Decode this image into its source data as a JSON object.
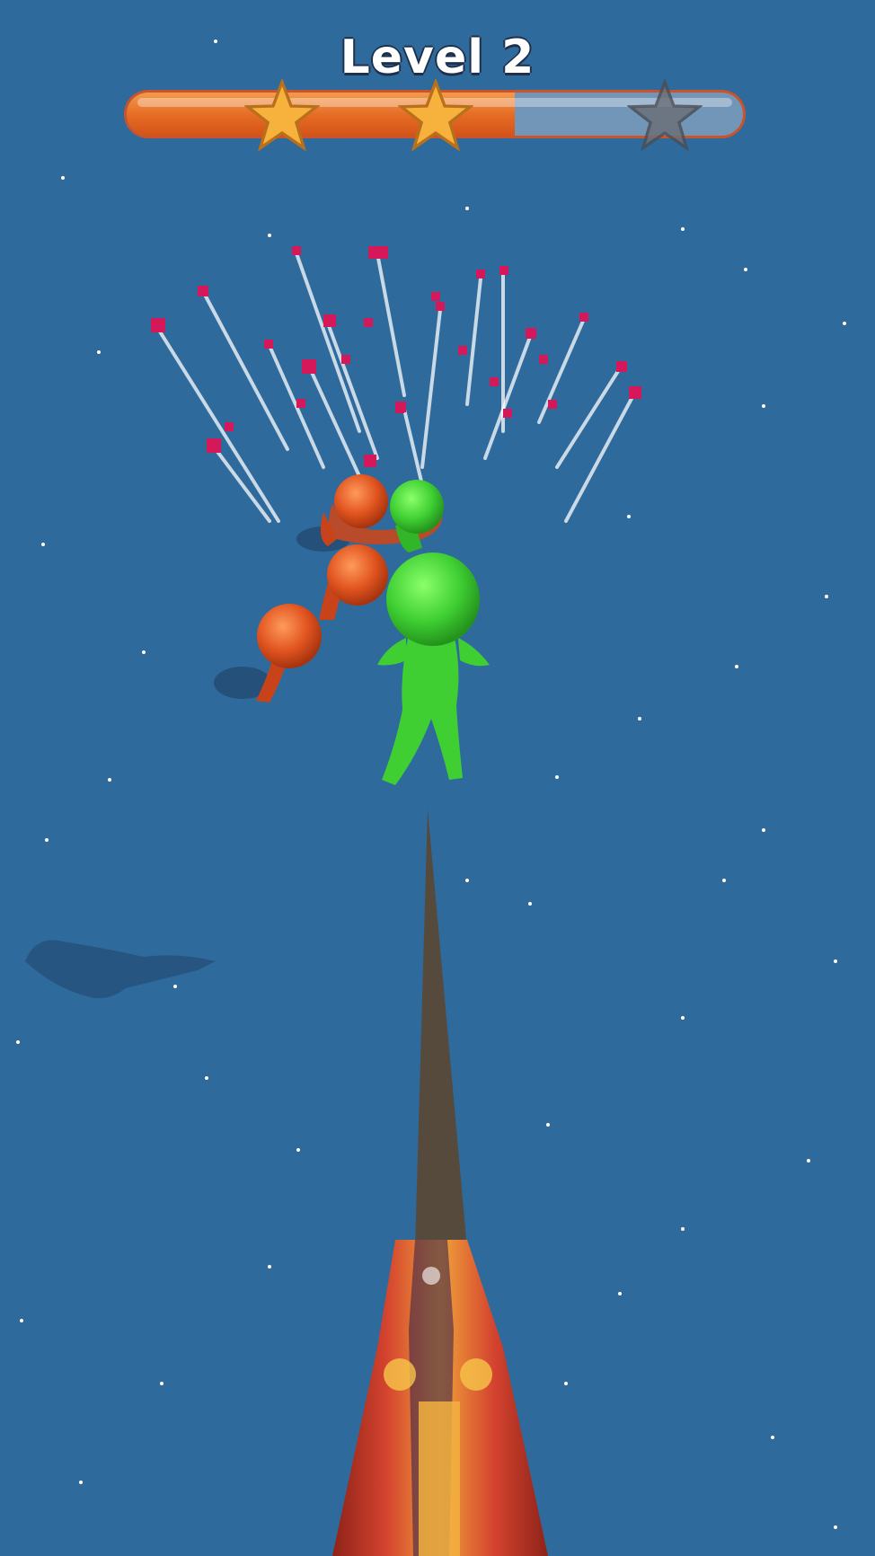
{
  "hud": {
    "level_label": "Level 2",
    "progress": 0.63,
    "stars": [
      {
        "name": "star-1",
        "earned": true
      },
      {
        "name": "star-2",
        "earned": true
      },
      {
        "name": "star-3",
        "earned": false
      }
    ]
  },
  "colors": {
    "water": "#2f6a9d",
    "progress_fill": "#e56a24",
    "star_gold": "#f6b23c",
    "star_locked": "#6b6f77",
    "player": "#3fcf33",
    "enemy": "#e0531f",
    "confetti": "#d4185a",
    "weapon": "#c8392b"
  },
  "scene": {
    "player_icon": "green-stickman",
    "enemy_icon": "orange-stickman",
    "weapon_icon": "spear-launcher"
  }
}
